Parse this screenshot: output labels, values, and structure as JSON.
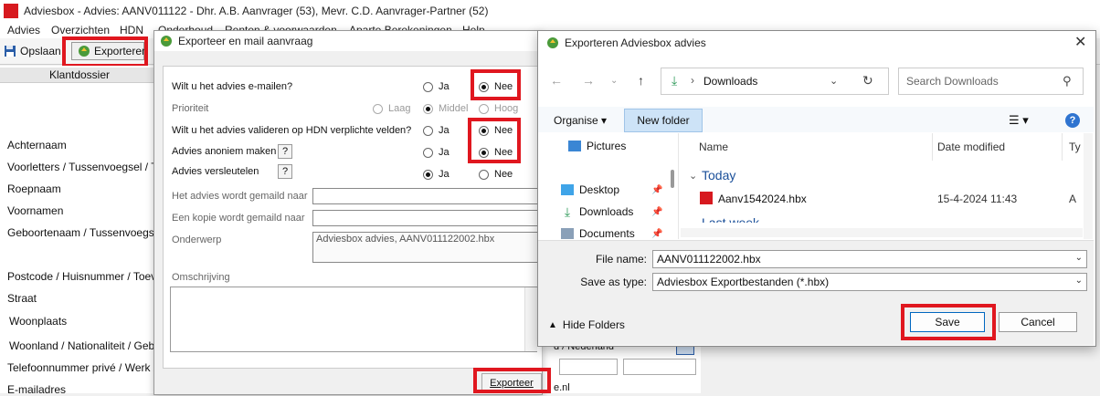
{
  "app": {
    "title": "Adviesbox - Advies: AANV011122 - Dhr. A.B. Aanvrager (53), Mevr. C.D. Aanvrager-Partner (52)",
    "menu": [
      "Advies",
      "Overzichten",
      "HDN",
      "Onderhoud",
      "Renten & voorwaarden",
      "Aparte Berekeningen",
      "Help"
    ],
    "toolbar": {
      "save_label": "Opslaan",
      "export_label": "Exporteren"
    },
    "left_header": "Klantdossier",
    "field_labels": [
      "Achternaam",
      "Voorletters / Tussenvoegsel / Tite",
      "Roepnaam",
      "Voornamen",
      "Geboortenaam / Tussenvoegsel",
      "Postcode / Huisnummer / Toevoeg",
      "Straat",
      "Woonplaats",
      "Woonland / Nationaliteit / Geboort",
      "Telefoonnummer privé / Werk / Mo",
      "E-mailadres"
    ],
    "behind_country": "d / Nederland",
    "behind_email": "e.nl"
  },
  "mail_dialog": {
    "title": "Exporteer en mail aanvraag",
    "q_email": "Wilt u het advies e-mailen?",
    "q_prioriteit": "Prioriteit",
    "q_valideren": "Wilt u het advies valideren op HDN verplichte velden?",
    "q_anoniem": "Advies anoniem maken",
    "q_versleutelen": "Advies versleutelen",
    "opt_ja": "Ja",
    "opt_nee": "Nee",
    "opt_laag": "Laag",
    "opt_middel": "Middel",
    "opt_hoog": "Hoog",
    "help_q": "?",
    "lbl_gemaild": "Het advies wordt gemaild naar",
    "lbl_kopie": "Een kopie wordt gemaild naar",
    "lbl_onderwerp": "Onderwerp",
    "onderwerp_value": "Adviesbox advies, AANV011122002.hbx",
    "lbl_omschrijving": "Omschrijving",
    "export_button": "Exporteer"
  },
  "save_dialog": {
    "title": "Exporteren Adviesbox advies",
    "location": "Downloads",
    "search_placeholder": "Search Downloads",
    "organise": "Organise",
    "new_folder": "New folder",
    "nav": [
      "Pictures",
      "Desktop",
      "Downloads",
      "Documents"
    ],
    "col_name": "Name",
    "col_date": "Date modified",
    "col_type": "Ty",
    "group_today": "Today",
    "group_lastweek": "Last week",
    "file_name": "Aanv1542024.hbx",
    "file_date": "15-4-2024 11:43",
    "file_type": "A",
    "lbl_filename": "File name:",
    "filename_value": "AANV011122002.hbx",
    "lbl_savetype": "Save as type:",
    "savetype_value": "Adviesbox Exportbestanden (*.hbx)",
    "hide_folders": "Hide Folders",
    "save_button": "Save",
    "cancel_button": "Cancel"
  },
  "colors": {
    "highlight": "#e0171f",
    "brand": "#d7191f",
    "accent": "#2f74d0"
  }
}
